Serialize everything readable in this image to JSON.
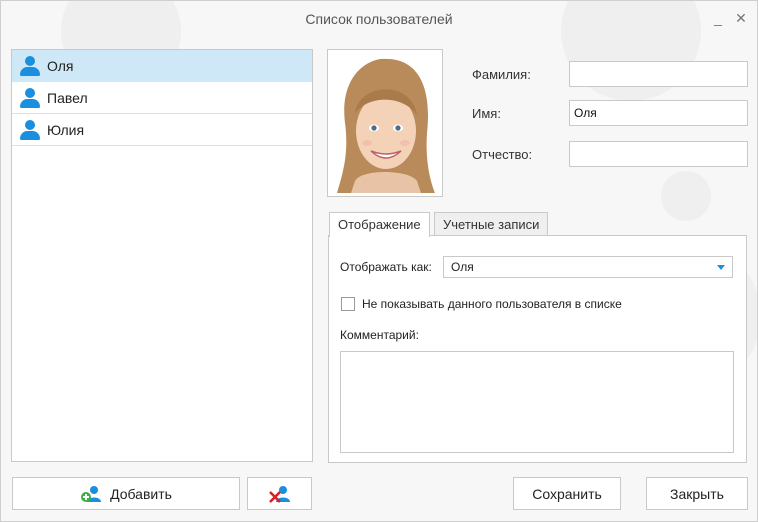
{
  "window": {
    "title": "Список пользователей",
    "minimize_icon": "minimize-icon",
    "close_icon": "close-icon"
  },
  "users": [
    {
      "name": "Оля",
      "selected": true
    },
    {
      "name": "Павел",
      "selected": false
    },
    {
      "name": "Юлия",
      "selected": false
    }
  ],
  "form": {
    "lastname_label": "Фамилия:",
    "lastname_value": "",
    "firstname_label": "Имя:",
    "firstname_value": "Оля",
    "patronymic_label": "Отчество:",
    "patronymic_value": ""
  },
  "tabs": [
    {
      "label": "Отображение",
      "active": true
    },
    {
      "label": "Учетные записи",
      "active": false
    }
  ],
  "display_tab": {
    "display_as_label": "Отображать как:",
    "display_as_value": "Оля",
    "hide_checkbox_label": "Не показывать данного пользователя в списке",
    "hide_checked": false,
    "comment_label": "Комментарий:",
    "comment_value": ""
  },
  "buttons": {
    "add_label": "Добавить",
    "save_label": "Сохранить",
    "close_label": "Закрыть"
  },
  "colors": {
    "accent": "#1a8fe0",
    "selection": "#cfe8f7",
    "add_badge": "#3cb043",
    "delete_x": "#e02020"
  }
}
